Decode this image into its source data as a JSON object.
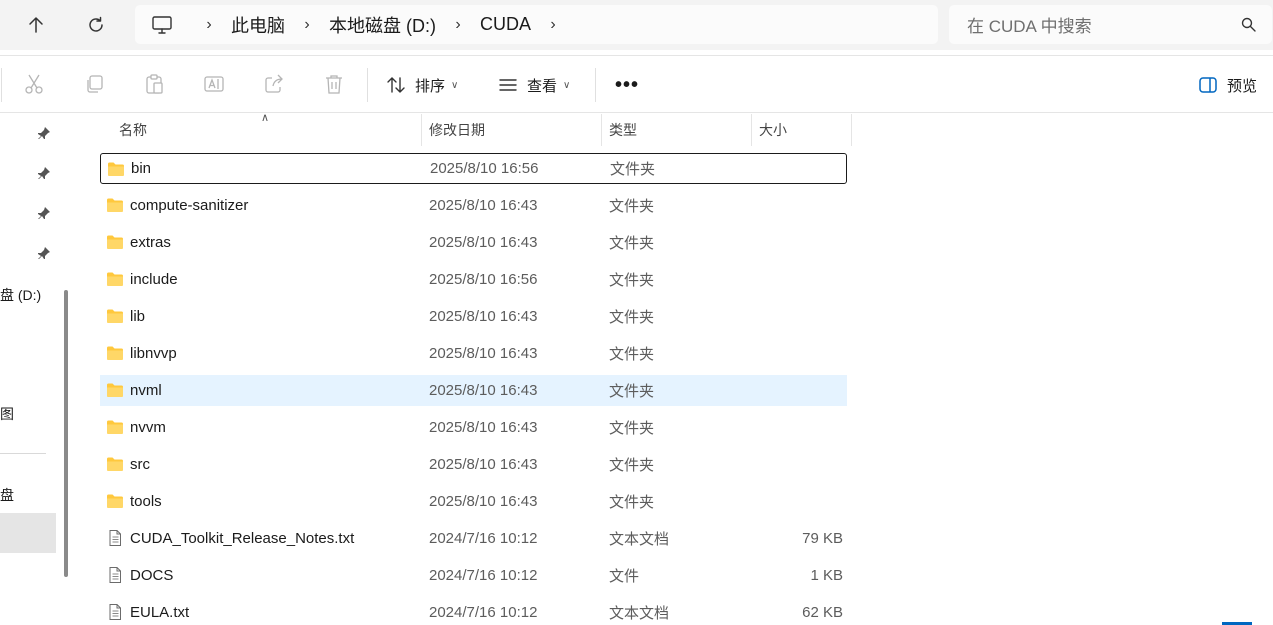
{
  "address": {
    "crumbs": [
      "此电脑",
      "本地磁盘 (D:)",
      "CUDA"
    ]
  },
  "search": {
    "placeholder": "在 CUDA 中搜索"
  },
  "toolbar": {
    "sort_label": "排序",
    "view_label": "查看",
    "more_label": "•••",
    "preview_label": "预览"
  },
  "nav": {
    "drive_label": "盘 (D:)",
    "item_label_1": "图",
    "item_label_2": "盘"
  },
  "columns": {
    "name": "名称",
    "modified": "修改日期",
    "type": "类型",
    "size": "大小"
  },
  "files": [
    {
      "name": "bin",
      "date": "2025/8/10 16:56",
      "type": "文件夹",
      "size": "",
      "kind": "folder"
    },
    {
      "name": "compute-sanitizer",
      "date": "2025/8/10 16:43",
      "type": "文件夹",
      "size": "",
      "kind": "folder"
    },
    {
      "name": "extras",
      "date": "2025/8/10 16:43",
      "type": "文件夹",
      "size": "",
      "kind": "folder"
    },
    {
      "name": "include",
      "date": "2025/8/10 16:56",
      "type": "文件夹",
      "size": "",
      "kind": "folder"
    },
    {
      "name": "lib",
      "date": "2025/8/10 16:43",
      "type": "文件夹",
      "size": "",
      "kind": "folder"
    },
    {
      "name": "libnvvp",
      "date": "2025/8/10 16:43",
      "type": "文件夹",
      "size": "",
      "kind": "folder"
    },
    {
      "name": "nvml",
      "date": "2025/8/10 16:43",
      "type": "文件夹",
      "size": "",
      "kind": "folder"
    },
    {
      "name": "nvvm",
      "date": "2025/8/10 16:43",
      "type": "文件夹",
      "size": "",
      "kind": "folder"
    },
    {
      "name": "src",
      "date": "2025/8/10 16:43",
      "type": "文件夹",
      "size": "",
      "kind": "folder"
    },
    {
      "name": "tools",
      "date": "2025/8/10 16:43",
      "type": "文件夹",
      "size": "",
      "kind": "folder"
    },
    {
      "name": "CUDA_Toolkit_Release_Notes.txt",
      "date": "2024/7/16 10:12",
      "type": "文本文档",
      "size": "79 KB",
      "kind": "file"
    },
    {
      "name": "DOCS",
      "date": "2024/7/16 10:12",
      "type": "文件",
      "size": "1 KB",
      "kind": "file"
    },
    {
      "name": "EULA.txt",
      "date": "2024/7/16 10:12",
      "type": "文本文档",
      "size": "62 KB",
      "kind": "file"
    }
  ],
  "colors": {
    "folder_yellow": "#ffc83d",
    "hover_bg": "#e5f3ff",
    "accent": "#0067c0"
  }
}
